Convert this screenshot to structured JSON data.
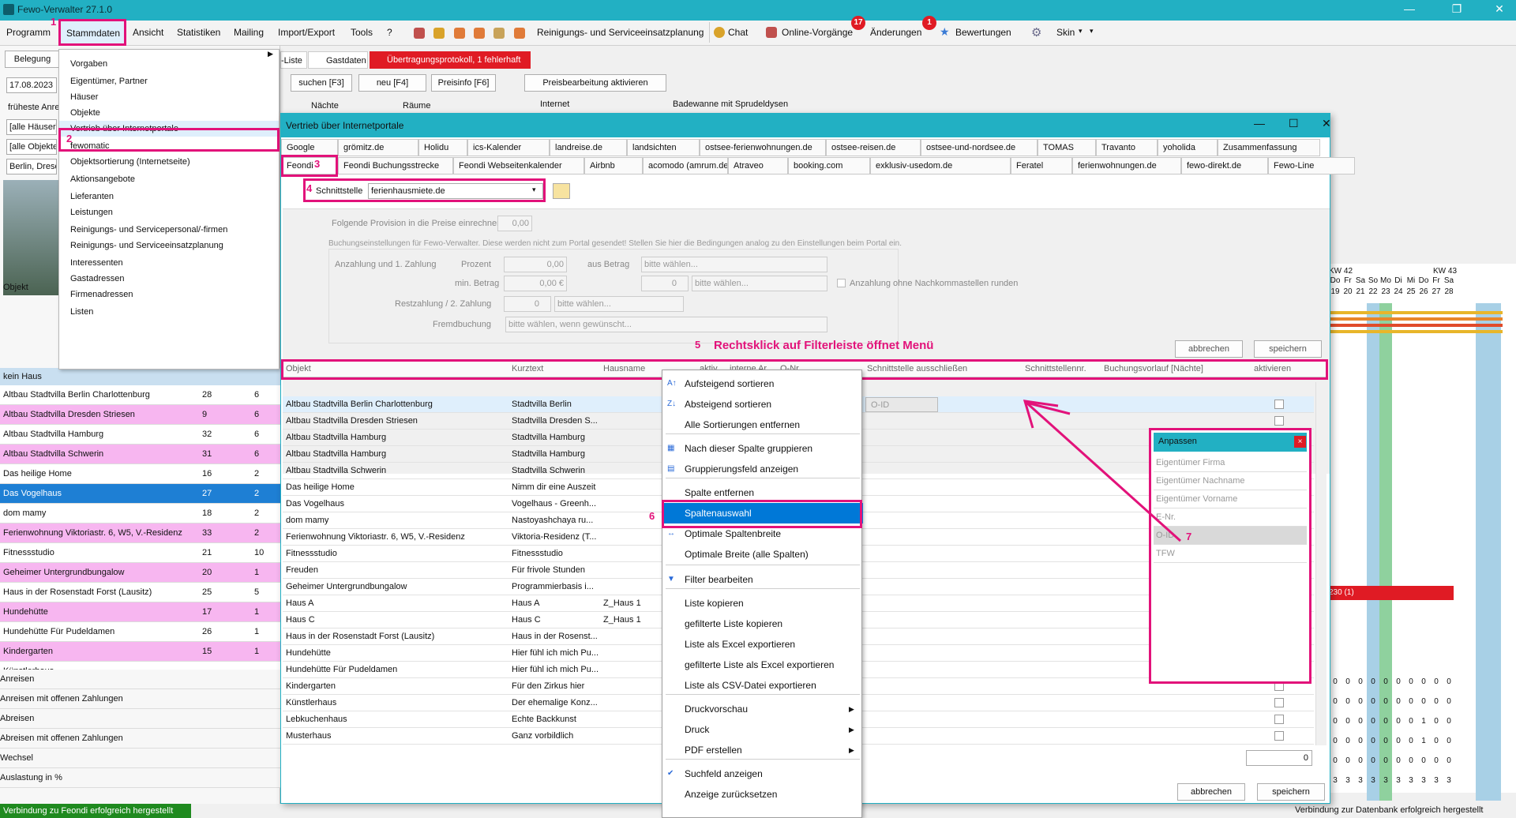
{
  "window": {
    "title": "Fewo-Verwalter 27.1.0"
  },
  "menubar": {
    "items": [
      "Programm",
      "Stammdaten",
      "Ansicht",
      "Statistiken",
      "Mailing",
      "Import/Export",
      "Tools",
      "?"
    ],
    "reinigung": "Reinigungs- und Serviceeinsatzplanung",
    "chat": "Chat",
    "online": "Online-Vorgänge",
    "online_badge": "17",
    "aenderungen": "Änderungen",
    "aenderungen_badge": "1",
    "bewertungen": "Bewertungen",
    "skin": "Skin"
  },
  "stammdaten_menu": {
    "items": [
      "Vorgaben",
      "Eigentümer, Partner",
      "Häuser",
      "Objekte",
      "Vertrieb über Internetportale",
      "fewomatic",
      "Objektsortierung (Internetseite)",
      "Aktionsangebote",
      "Lieferanten",
      "Leistungen",
      "Reinigungs- und Servicepersonal/-firmen",
      "Reinigungs- und Serviceeinsatzplanung",
      "Interessenten",
      "Gastadressen",
      "Firmenadressen",
      "Listen"
    ]
  },
  "left": {
    "belegung": "Belegung",
    "date": "17.08.2023",
    "frueheste": "früheste Anre",
    "alle_haeuser": "[alle Häuser]",
    "alle_objekte": "[alle Objekte]",
    "ort": "Berlin, Dresd",
    "objekt": "Objekt",
    "kein_haus": "kein Haus",
    "rows": [
      {
        "name": "Altbau Stadtvilla Berlin Charlottenburg",
        "a": "28",
        "b": "6",
        "c": "#ffffff"
      },
      {
        "name": "Altbau Stadtvilla Dresden Striesen",
        "a": "9",
        "b": "6",
        "c": "#f7b6f0"
      },
      {
        "name": "Altbau Stadtvilla Hamburg",
        "a": "32",
        "b": "6",
        "c": "#ffffff"
      },
      {
        "name": "Altbau Stadtvilla Schwerin",
        "a": "31",
        "b": "6",
        "c": "#f7b6f0"
      },
      {
        "name": "Das heilige Home",
        "a": "16",
        "b": "2",
        "c": "#ffffff"
      },
      {
        "name": "Das Vogelhaus",
        "a": "27",
        "b": "2",
        "c": "#1e7fd4"
      },
      {
        "name": "dom mamy",
        "a": "18",
        "b": "2",
        "c": "#ffffff"
      },
      {
        "name": "Ferienwohnung Viktoriastr. 6, W5, V.-Residenz",
        "a": "33",
        "b": "2",
        "c": "#f7b6f0"
      },
      {
        "name": "Fitnessstudio",
        "a": "21",
        "b": "10",
        "c": "#ffffff"
      },
      {
        "name": "Geheimer Untergrundbungalow",
        "a": "20",
        "b": "1",
        "c": "#f7b6f0"
      },
      {
        "name": "Haus in der Rosenstadt Forst (Lausitz)",
        "a": "25",
        "b": "5",
        "c": "#ffffff"
      },
      {
        "name": "Hundehütte",
        "a": "17",
        "b": "1",
        "c": "#f7b6f0"
      },
      {
        "name": "Hundehütte Für Pudeldamen",
        "a": "26",
        "b": "1",
        "c": "#ffffff"
      },
      {
        "name": "Kindergarten",
        "a": "15",
        "b": "1",
        "c": "#f7b6f0"
      },
      {
        "name": "Künstlerhaus",
        "a": "",
        "b": "",
        "c": "#ffffff"
      }
    ],
    "bottom": [
      "Anreisen",
      "Anreisen mit offenen Zahlungen",
      "Abreisen",
      "Abreisen mit offenen Zahlungen",
      "Wechsel",
      "Auslastung in %"
    ],
    "status": "Verbindung zu Feondi erfolgreich hergestellt"
  },
  "bg": {
    "tab_liste": "-Liste",
    "tab_gastdaten": "Gastdaten",
    "tab_protokoll": "Übertragungsprotokoll, 1 fehlerhaft",
    "suchen": "suchen [F3]",
    "neu": "neu [F4]",
    "preisinfo": "Preisinfo [F6]",
    "preisbearbeitung": "Preisbearbeitung aktivieren",
    "naechte": "Nächte",
    "raeume": "Räume",
    "internet": "Internet",
    "badewanne": "Badewanne mit Sprudeldysen",
    "status_right": "Verbindung zur Datenbank erfolgreich hergestellt"
  },
  "calendar": {
    "kw42": "KW 42",
    "kw43": "KW 43",
    "days": [
      "Do",
      "Fr",
      "Sa",
      "So",
      "Mo",
      "Di",
      "Mi",
      "Do",
      "Fr",
      "Sa"
    ],
    "dates": [
      "19",
      "20",
      "21",
      "22",
      "23",
      "24",
      "25",
      "26",
      "27",
      "28"
    ],
    "booking": "230 (1)",
    "zero_rows": [
      [
        "0",
        "0",
        "0",
        "0",
        "0",
        "0",
        "0",
        "0",
        "0",
        "0"
      ],
      [
        "0",
        "0",
        "0",
        "0",
        "0",
        "0",
        "0",
        "0",
        "0",
        "0"
      ],
      [
        "0",
        "0",
        "0",
        "0",
        "0",
        "0",
        "0",
        "1",
        "0",
        "0"
      ],
      [
        "0",
        "0",
        "0",
        "0",
        "0",
        "0",
        "0",
        "1",
        "0",
        "0"
      ],
      [
        "0",
        "0",
        "0",
        "0",
        "0",
        "0",
        "0",
        "0",
        "0",
        "0"
      ],
      [
        "3",
        "3",
        "3",
        "3",
        "3",
        "3",
        "3",
        "3",
        "3",
        "3"
      ]
    ]
  },
  "dialog": {
    "title": "Vertrieb über Internetportale",
    "tabs_row1": [
      "Google",
      "grömitz.de",
      "Holidu",
      "ics-Kalender",
      "landreise.de",
      "landsichten",
      "ostsee-ferienwohnungen.de",
      "ostsee-reisen.de",
      "ostsee-und-nordsee.de",
      "TOMAS",
      "Travanto",
      "yoholida",
      "Zusammenfassung"
    ],
    "tabs_row2": [
      "Feondi",
      "Feondi Buchungsstrecke",
      "Feondi Webseitenkalender",
      "Airbnb",
      "acomodo (amrum.de)",
      "Atraveo",
      "booking.com",
      "exklusiv-usedom.de",
      "Feratel",
      "ferienwohnungen.de",
      "fewo-direkt.de",
      "Fewo-Line"
    ],
    "schnittstelle_label": "Schnittstelle",
    "schnittstelle_value": "ferienhausmiete.de",
    "provision_label": "Folgende Provision in die Preise einrechnen",
    "provision_value": "0,00",
    "buchung_info": "Buchungseinstellungen für Fewo-Verwalter. Diese werden nicht zum Portal gesendet! Stellen Sie hier die Bedingungen analog zu den Einstellungen beim Portal ein.",
    "anzahlung": "Anzahlung und 1. Zahlung",
    "prozent": "Prozent",
    "prozent_val": "0,00",
    "aus_betrag": "aus Betrag",
    "bitte1": "bitte wählen...",
    "min_betrag": "min. Betrag",
    "min_val": "0,00 €",
    "min_num": "0",
    "bitte2": "bitte wählen...",
    "ohne_nachkomma": "Anzahlung ohne Nachkommastellen runden",
    "restzahlung": "Restzahlung / 2. Zahlung",
    "rest_num": "0",
    "bitte3": "bitte wählen...",
    "fremdbuchung": "Fremdbuchung",
    "bitte_fremd": "bitte wählen, wenn gewünscht...",
    "abbrechen": "abbrechen",
    "speichern": "speichern",
    "columns": [
      "Objekt",
      "Kurztext",
      "Hausname",
      "aktiv",
      "interne Ar",
      "O-Nr.",
      "Schnittstelle ausschließen",
      "Schnittstellennr.",
      "Buchungsvorlauf [Nächte]",
      "aktivieren"
    ],
    "oid_placeholder": "O-ID",
    "rows": [
      [
        "Altbau Stadtvilla Berlin Charlottenburg",
        "Stadtvilla Berlin",
        ""
      ],
      [
        "Altbau Stadtvilla Dresden Striesen",
        "Stadtvilla Dresden S...",
        ""
      ],
      [
        "Altbau Stadtvilla Hamburg",
        "Stadtvilla Hamburg",
        ""
      ],
      [
        "Altbau Stadtvilla Hamburg",
        "Stadtvilla Hamburg",
        ""
      ],
      [
        "Altbau Stadtvilla Schwerin",
        "Stadtvilla Schwerin",
        ""
      ],
      [
        "Das heilige Home",
        "Nimm dir eine Auszeit",
        ""
      ],
      [
        "Das Vogelhaus",
        "Vogelhaus - Greenh...",
        ""
      ],
      [
        "dom mamy",
        "Nastoyashchaya ru...",
        ""
      ],
      [
        "Ferienwohnung Viktoriastr. 6, W5, V.-Residenz",
        "Viktoria-Residenz (T...",
        ""
      ],
      [
        "Fitnessstudio",
        "Fitnessstudio",
        ""
      ],
      [
        "Freuden",
        "Für frivole Stunden",
        ""
      ],
      [
        "Geheimer Untergrundbungalow",
        "Programmierbasis i...",
        ""
      ],
      [
        "Haus A",
        "Haus A",
        "Z_Haus 1"
      ],
      [
        "Haus C",
        "Haus C",
        "Z_Haus 1"
      ],
      [
        "Haus in der Rosenstadt Forst (Lausitz)",
        "Haus in der Rosenst...",
        ""
      ],
      [
        "Hundehütte",
        "Hier fühl ich mich Pu...",
        ""
      ],
      [
        "Hundehütte Für Pudeldamen",
        "Hier fühl ich mich Pu...",
        ""
      ],
      [
        "Kindergarten",
        "Für den Zirkus hier",
        ""
      ],
      [
        "Künstlerhaus",
        "Der ehemalige Konz...",
        ""
      ],
      [
        "Lebkuchenhaus",
        "Echte Backkunst",
        ""
      ],
      [
        "Musterhaus",
        "Ganz vorbildlich",
        ""
      ]
    ],
    "sum_value": "0",
    "abbrechen2": "abbrechen",
    "speichern2": "speichern"
  },
  "context_menu": {
    "items": [
      "Aufsteigend sortieren",
      "Absteigend sortieren",
      "Alle Sortierungen entfernen",
      "Nach dieser Spalte gruppieren",
      "Gruppierungsfeld anzeigen",
      "Spalte entfernen",
      "Spaltenauswahl",
      "Optimale Spaltenbreite",
      "Optimale Breite (alle Spalten)",
      "Filter bearbeiten",
      "Liste kopieren",
      "gefilterte Liste kopieren",
      "Liste als Excel exportieren",
      "gefilterte Liste als Excel exportieren",
      "Liste als CSV-Datei exportieren",
      "Druckvorschau",
      "Druck",
      "PDF erstellen",
      "Suchfeld anzeigen",
      "Anzeige zurücksetzen"
    ]
  },
  "anpassen": {
    "title": "Anpassen",
    "items": [
      "Eigentümer Firma",
      "Eigentümer Nachname",
      "Eigentümer Vorname",
      "E-Nr.",
      "O-ID",
      "TFW"
    ]
  },
  "annotations": {
    "n1": "1",
    "n2": "2",
    "n3": "3",
    "n4": "4",
    "n5": "5",
    "n5_text": "Rechtsklick auf Filterleiste öffnet Menü",
    "n6": "6",
    "n7": "7"
  },
  "colors": {
    "accent": "#22b0c3",
    "highlight": "#e2127a",
    "selection": "#0078d7",
    "row_pink": "#f7b6f0"
  }
}
